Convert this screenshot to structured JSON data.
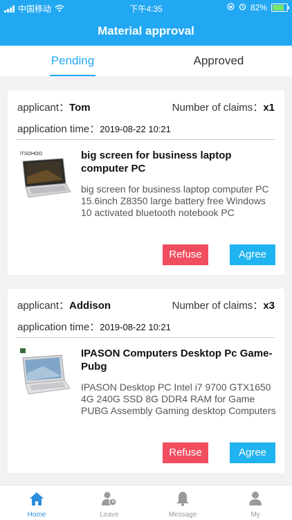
{
  "status_bar": {
    "carrier": "中国移动",
    "time": "下午4:35",
    "battery": "82%"
  },
  "header": {
    "title": "Material approval"
  },
  "tabs": [
    {
      "label": "Pending",
      "active": true
    },
    {
      "label": "Approved",
      "active": false
    }
  ],
  "requests": [
    {
      "applicant_label": "applicant：",
      "applicant": "Tom",
      "claims_label": "Number of claims：",
      "claims": "x1",
      "time_label": "application time：",
      "time": "2019-08-22 10:21",
      "product_title": "big screen for business laptop computer PC",
      "product_desc": "big screen for business laptop computer PC 15.6inch Z8350 large battery free Windows 10 activated bluetooth notebook PC",
      "thumb_brand": "iTSOHOO",
      "refuse": "Refuse",
      "agree": "Agree"
    },
    {
      "applicant_label": "applicant：",
      "applicant": "Addison",
      "claims_label": "Number of claims：",
      "claims": "x3",
      "time_label": "application time：",
      "time": "2019-08-22 10:21",
      "product_title": "IPASON Computers Desktop Pc Game-Pubg",
      "product_desc": "IPASON Desktop PC Intel i7 9700 GTX1650 4G 240G SSD 8G DDR4 RAM for Game PUBG Assembly Gaming desktop Computers",
      "refuse": "Refuse",
      "agree": "Agree"
    }
  ],
  "bottom_nav": [
    {
      "label": "Home",
      "icon": "home-icon",
      "active": true
    },
    {
      "label": "Leave",
      "icon": "leave-icon",
      "active": false
    },
    {
      "label": "Message",
      "icon": "bell-icon",
      "active": false
    },
    {
      "label": "My",
      "icon": "person-icon",
      "active": false
    }
  ],
  "colors": {
    "primary": "#22a8f2",
    "refuse": "#f04d5f",
    "agree": "#1fb3ef",
    "nav_active": "#2b8fe0"
  }
}
